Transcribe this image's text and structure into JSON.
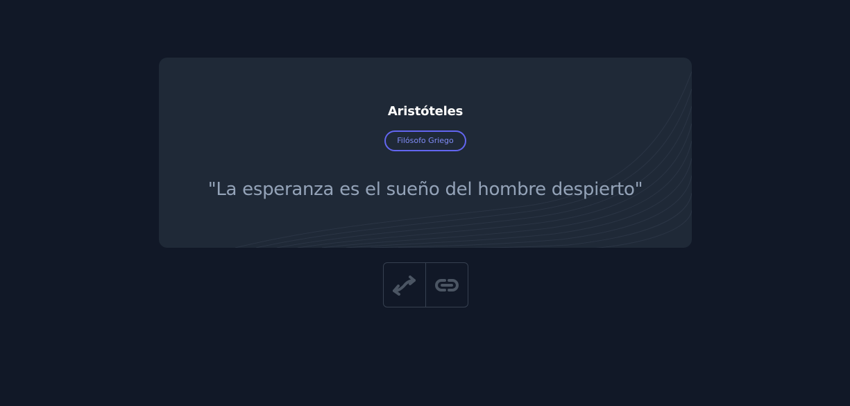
{
  "quote_card": {
    "author": "Aristóteles",
    "badge": "Filósofo Griego",
    "quote": "\"La esperanza es el sueño del hombre despierto\""
  },
  "actions": {
    "shuffle_icon": "shuffle-arrows-icon",
    "link_icon": "link-icon"
  },
  "colors": {
    "background": "#111827",
    "card": "#1f2937",
    "accent": "#6366f1",
    "quote_text": "#94a3b8",
    "icon": "#4b5563"
  }
}
